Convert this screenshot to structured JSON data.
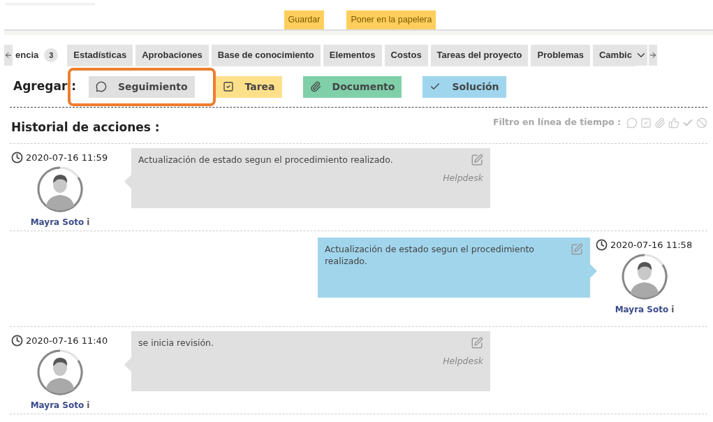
{
  "toolbar": {
    "buttons": [
      "Guardar",
      "Poner en la papelera"
    ]
  },
  "tabs": [
    {
      "label": "encia",
      "badge": "3",
      "selected": true
    },
    {
      "label": "Estadísticas",
      "selected": false
    },
    {
      "label": "Aprobaciones",
      "selected": false
    },
    {
      "label": "Base de conocimiento",
      "selected": false
    },
    {
      "label": "Elementos",
      "selected": false
    },
    {
      "label": "Costos",
      "selected": false
    },
    {
      "label": "Tareas del proyecto",
      "selected": false
    },
    {
      "label": "Problemas",
      "selected": false
    },
    {
      "label": "Cambic",
      "selected": false
    }
  ],
  "add": {
    "label": "Agregar :",
    "buttons": [
      {
        "kind": "followup",
        "label": "Seguimiento",
        "highlighted": true
      },
      {
        "kind": "task",
        "label": "Tarea",
        "highlighted": false
      },
      {
        "kind": "document",
        "label": "Documento",
        "highlighted": false
      },
      {
        "kind": "solution",
        "label": "Solución",
        "highlighted": false
      }
    ]
  },
  "history": {
    "title": "Historial de acciones :",
    "filter_label": "Filtro en línea de tiempo :",
    "entries": [
      {
        "kind": "followup",
        "date": "2020-07-16 11:59",
        "text": "Actualización de estado segun el procedimiento realizado.",
        "source": "Helpdesk",
        "author": "Mayra Soto",
        "info": "i"
      },
      {
        "kind": "solution",
        "date": "2020-07-16 11:58",
        "text": "Actualización de estado segun el procedimiento realizado.",
        "author": "Mayra Soto",
        "info": "i"
      },
      {
        "kind": "followup",
        "date": "2020-07-16 11:40",
        "text": "se inicia revisión.",
        "source": "Helpdesk",
        "author": "Mayra Soto",
        "info": "i"
      }
    ]
  }
}
